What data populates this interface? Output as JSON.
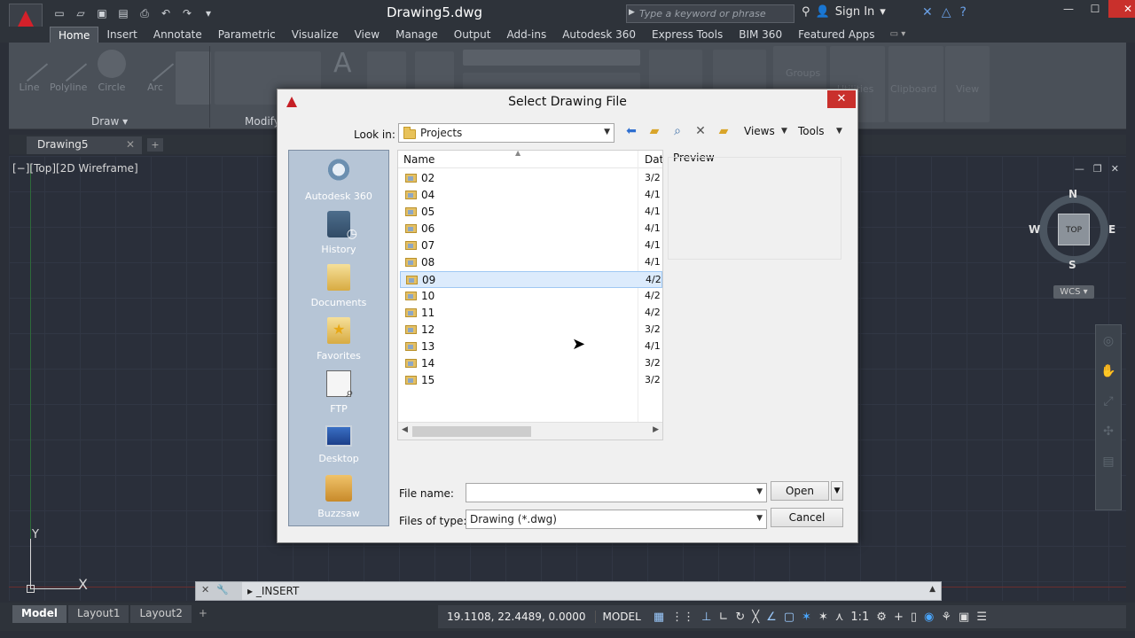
{
  "app": {
    "document_title": "Drawing5.dwg",
    "search_placeholder": "Type a keyword or phrase",
    "sign_in_label": "Sign In"
  },
  "ribbon_tabs": [
    "Home",
    "Insert",
    "Annotate",
    "Parametric",
    "Visualize",
    "View",
    "Manage",
    "Output",
    "Add-ins",
    "Autodesk 360",
    "Express Tools",
    "BIM 360",
    "Featured Apps"
  ],
  "ribbon": {
    "tools": [
      "Line",
      "Polyline",
      "Circle",
      "Arc"
    ],
    "ghost_tools": [
      "Groups",
      "Utilities",
      "Clipboard",
      "View"
    ],
    "panels": [
      "Draw",
      "Modify"
    ]
  },
  "file_tab": {
    "label": "Drawing5"
  },
  "viewport": {
    "label": "[−][Top][2D Wireframe]",
    "viewcube": {
      "top": "TOP",
      "n": "N",
      "s": "S",
      "e": "E",
      "w": "W"
    },
    "wcs_label": "WCS",
    "ucs_x": "X",
    "ucs_y": "Y"
  },
  "command_line": {
    "text": "_INSERT"
  },
  "layout_tabs": [
    "Model",
    "Layout1",
    "Layout2"
  ],
  "status": {
    "coords": "19.1108, 22.4489, 0.0000",
    "model_label": "MODEL",
    "scale": "1:1"
  },
  "dialog": {
    "title": "Select Drawing File",
    "look_in_label": "Look in:",
    "look_in_value": "Projects",
    "views_label": "Views",
    "tools_label": "Tools",
    "places": [
      "Autodesk 360",
      "History",
      "Documents",
      "Favorites",
      "FTP",
      "Desktop",
      "Buzzsaw"
    ],
    "columns": {
      "name": "Name",
      "date": "Date"
    },
    "files": [
      {
        "name": "02",
        "date": "3/2"
      },
      {
        "name": "04",
        "date": "4/1"
      },
      {
        "name": "05",
        "date": "4/1"
      },
      {
        "name": "06",
        "date": "4/1"
      },
      {
        "name": "07",
        "date": "4/1"
      },
      {
        "name": "08",
        "date": "4/1"
      },
      {
        "name": "09",
        "date": "4/2"
      },
      {
        "name": "10",
        "date": "4/2"
      },
      {
        "name": "11",
        "date": "4/2"
      },
      {
        "name": "12",
        "date": "3/2"
      },
      {
        "name": "13",
        "date": "4/1"
      },
      {
        "name": "14",
        "date": "3/2"
      },
      {
        "name": "15",
        "date": "3/2"
      }
    ],
    "selected_file": "09",
    "preview_label": "Preview",
    "file_name_label": "File name:",
    "file_name_value": "",
    "files_of_type_label": "Files of type:",
    "files_of_type_value": "Drawing (*.dwg)",
    "open_label": "Open",
    "cancel_label": "Cancel"
  },
  "colors": {
    "accent_red": "#d4202a",
    "selection_blue": "#dcebfc",
    "places_bg": "#b6c5d6",
    "canvas_bg": "#2a2f3a"
  }
}
